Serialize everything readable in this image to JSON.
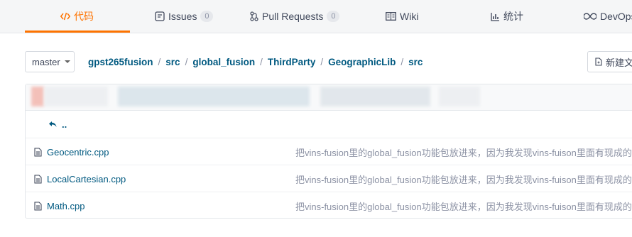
{
  "tabs": [
    {
      "id": "code",
      "label": "代码",
      "icon": "code-icon",
      "active": true
    },
    {
      "id": "issues",
      "label": "Issues",
      "icon": "issues-icon",
      "count": "0"
    },
    {
      "id": "pulls",
      "label": "Pull Requests",
      "icon": "pull-request-icon",
      "count": "0"
    },
    {
      "id": "wiki",
      "label": "Wiki",
      "icon": "wiki-icon"
    },
    {
      "id": "stats",
      "label": "统计",
      "icon": "stats-icon"
    },
    {
      "id": "devops",
      "label": "DevOps",
      "icon": "devops-icon"
    }
  ],
  "branch": {
    "name": "master"
  },
  "breadcrumb": [
    "gpst265fusion",
    "src",
    "global_fusion",
    "ThirdParty",
    "GeographicLib",
    "src"
  ],
  "actions": {
    "new_file_label": "新建文件"
  },
  "parent_link": "..",
  "files": [
    {
      "name": "Geocentric.cpp",
      "message": "把vins-fusion里的global_fusion功能包放进来，因为我发现vins-fuison里面有现成的东西"
    },
    {
      "name": "LocalCartesian.cpp",
      "message": "把vins-fusion里的global_fusion功能包放进来，因为我发现vins-fuison里面有现成的东西"
    },
    {
      "name": "Math.cpp",
      "message": "把vins-fusion里的global_fusion功能包放进来，因为我发现vins-fuison里面有现成的东西"
    }
  ],
  "colors": {
    "accent": "#fe7300",
    "link": "#005980",
    "muted": "#8c92a4"
  }
}
